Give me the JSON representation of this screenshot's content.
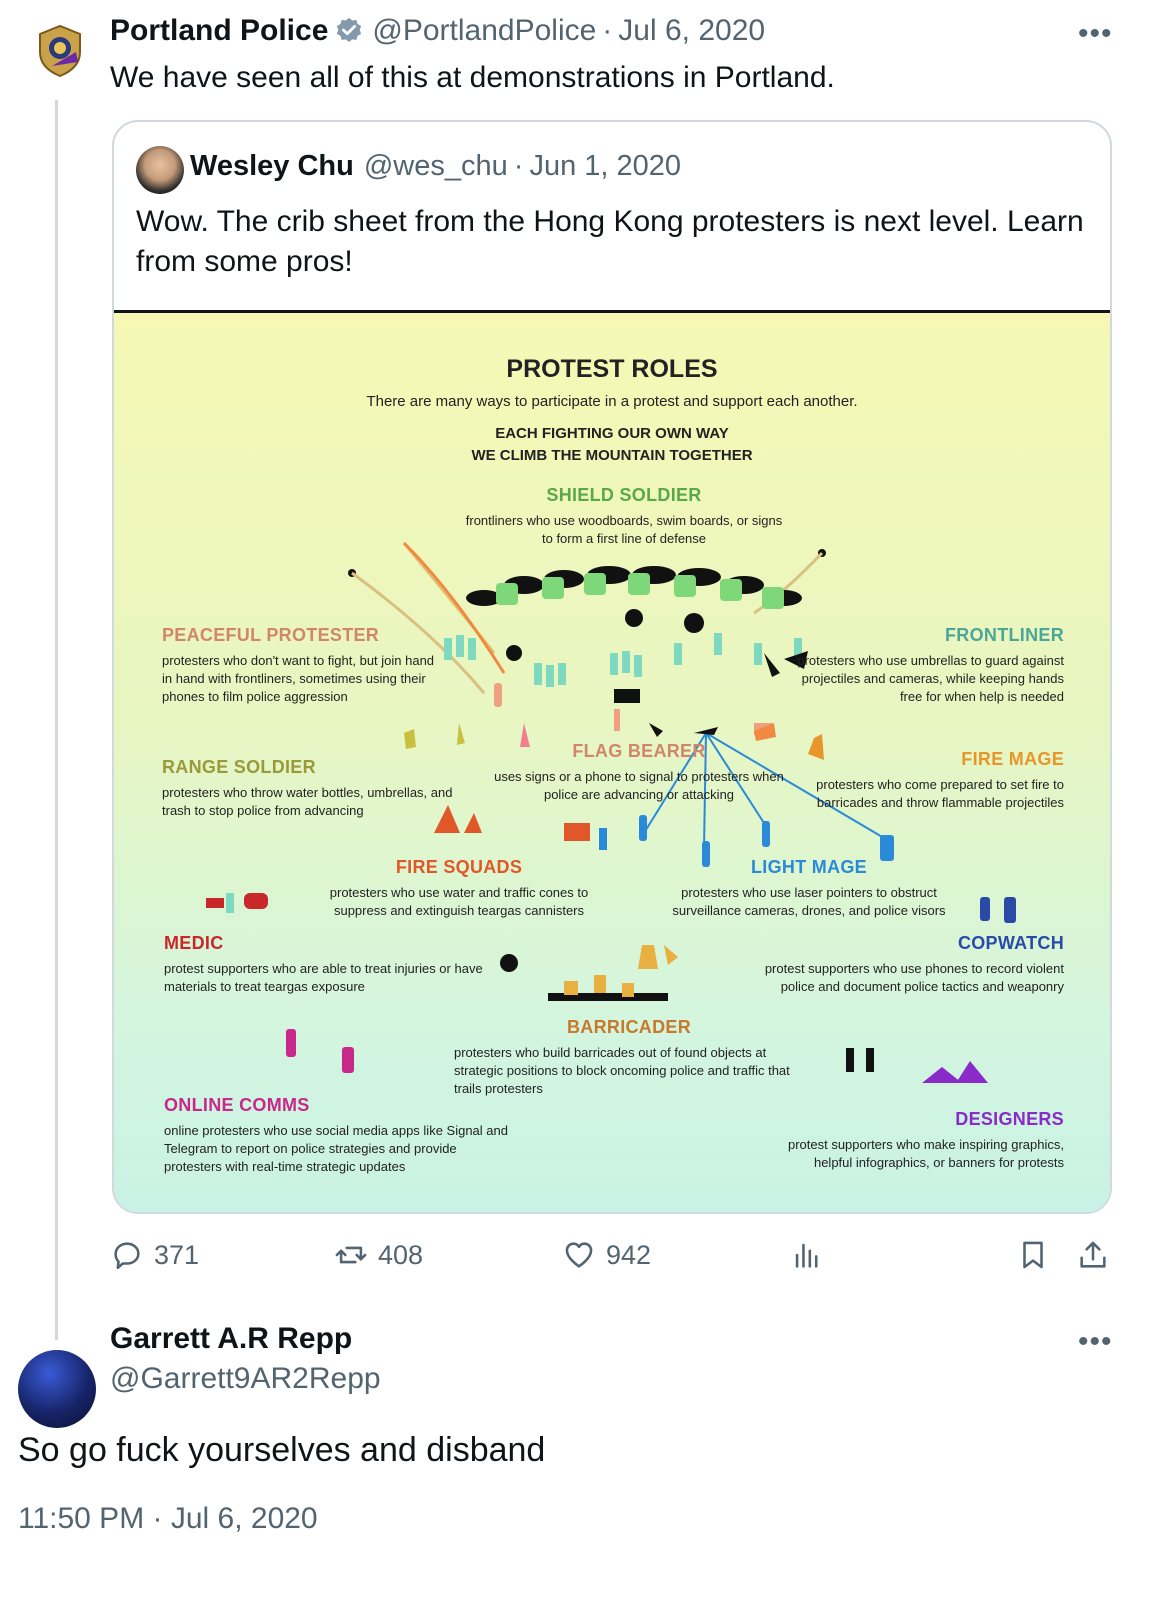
{
  "tweet": {
    "author_name": "Portland Police",
    "author_handle": "@PortlandPolice",
    "separator": "·",
    "date": "Jul 6, 2020",
    "text": "We have seen all of this at demonstrations in Portland.",
    "quoted": {
      "author_name": "Wesley Chu",
      "author_handle": "@wes_chu",
      "separator": "·",
      "date": "Jun 1, 2020",
      "text": "Wow. The crib sheet from the Hong Kong protesters is next level. Learn from some pros!",
      "infographic": {
        "title": "PROTEST ROLES",
        "subtitle": "There are many ways to participate in a protest and support each another.",
        "motto_line1": "EACH FIGHTING OUR OWN WAY",
        "motto_line2": "WE CLIMB THE MOUNTAIN TOGETHER",
        "roles": {
          "shield_soldier": {
            "title": "SHIELD SOLDIER",
            "desc": "frontliners who use woodboards, swim boards, or signs to form a first line of defense",
            "color": "#5aa84a"
          },
          "peaceful_protester": {
            "title": "PEACEFUL PROTESTER",
            "desc": "protesters who don't want to fight, but join hand in hand with frontliners, sometimes using their phones to film police aggression",
            "color": "#d0866a"
          },
          "frontliner": {
            "title": "FRONTLINER",
            "desc": "protesters who use umbrellas to guard against projectiles and cameras, while keeping hands free for when help is needed",
            "color": "#4aa69a"
          },
          "range_soldier": {
            "title": "RANGE SOLDIER",
            "desc": "protesters who throw water bottles, umbrellas, and trash to stop police from advancing",
            "color": "#9a9a3a"
          },
          "flag_bearer": {
            "title": "FLAG BEARER",
            "desc": "uses signs or a phone to signal to protesters when police are advancing or attacking",
            "color": "#d0866a"
          },
          "fire_mage": {
            "title": "FIRE MAGE",
            "desc": "protesters who come prepared to set fire to barricades and throw flammable projectiles",
            "color": "#e8962a"
          },
          "fire_squads": {
            "title": "FIRE SQUADS",
            "desc": "protesters who use water and traffic cones to suppress and extinguish teargas cannisters",
            "color": "#e0582a"
          },
          "light_mage": {
            "title": "LIGHT MAGE",
            "desc": "protesters who use laser pointers to obstruct surveillance cameras, drones, and police visors",
            "color": "#2a8ad8"
          },
          "medic": {
            "title": "MEDIC",
            "desc": "protest supporters who are able to treat injuries or have materials to treat teargas exposure",
            "color": "#c8282a"
          },
          "copwatch": {
            "title": "COPWATCH",
            "desc": "protest supporters who use phones to record violent police and document police tactics and weaponry",
            "color": "#2a4aa8"
          },
          "barricader": {
            "title": "BARRICADER",
            "desc": "protesters who build barricades out of found objects at strategic positions to block oncoming police and traffic that trails protesters",
            "color": "#c87a2a"
          },
          "online_comms": {
            "title": "ONLINE COMMS",
            "desc": "online protesters who use social media apps like Signal and Telegram to report on police strategies and provide protesters with real-time strategic updates",
            "color": "#c8288a"
          },
          "designers": {
            "title": "DESIGNERS",
            "desc": "protest supporters who make inspiring graphics, helpful infographics, or banners for protests",
            "color": "#8a2ac8"
          }
        }
      }
    },
    "stats": {
      "replies": "371",
      "reposts": "408",
      "likes": "942"
    }
  },
  "reply": {
    "author_name": "Garrett A.R Repp",
    "author_handle": "@Garrett9AR2Repp",
    "text": "So go fuck yourselves and disband",
    "timestamp": "11:50 PM · Jul 6, 2020"
  },
  "colors": {
    "verified": "#829aab",
    "secondary_text": "#536471",
    "border": "#cfd9de"
  },
  "icons": {
    "more": "more-horizontal-icon",
    "reply": "reply-icon",
    "repost": "repost-icon",
    "like": "heart-icon",
    "views": "views-icon",
    "bookmark": "bookmark-icon",
    "share": "share-icon"
  }
}
